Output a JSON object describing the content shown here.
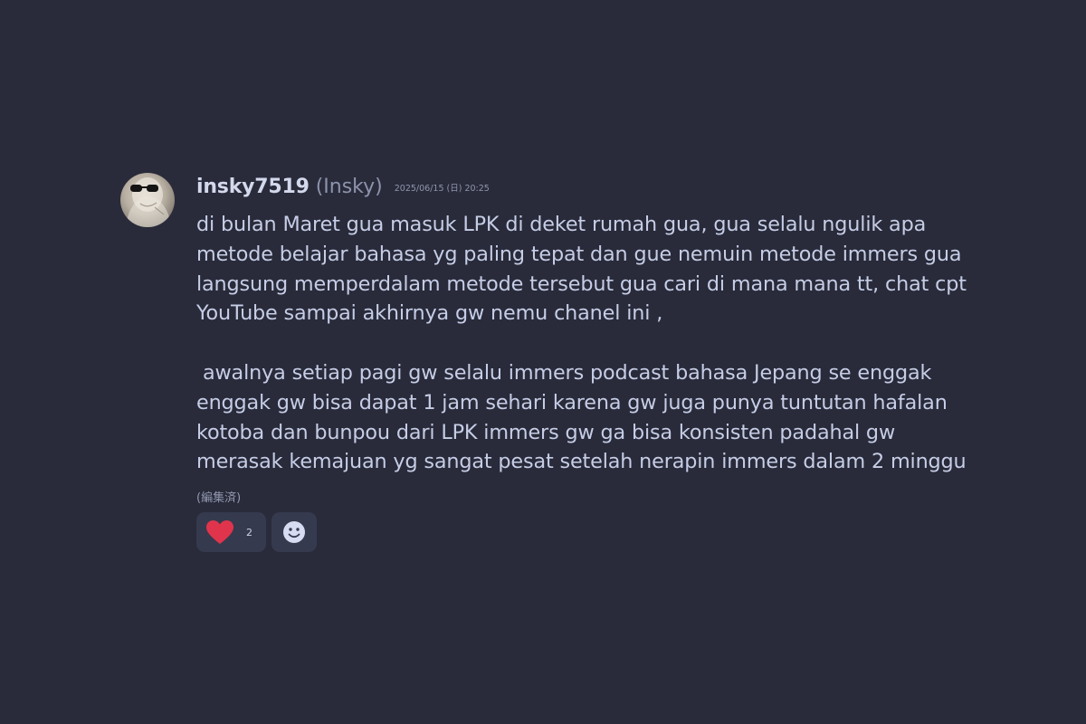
{
  "message": {
    "username": "insky7519",
    "display_name": "(Insky)",
    "timestamp": "2025/06/15 (日) 20:25",
    "body": "di bulan Maret gua masuk LPK di deket rumah gua, gua selalu ngulik apa\nmetode belajar bahasa yg paling tepat dan gue nemuin metode immers gua\nlangsung memperdalam metode tersebut gua cari di mana mana tt, chat cpt\nYouTube sampai akhirnya gw nemu chanel ini ,\n\n awalnya setiap pagi gw selalu immers podcast bahasa Jepang se enggak\nenggak gw bisa dapat 1 jam sehari karena gw juga punya tuntutan hafalan\nkotoba dan bunpou dari LPK immers gw ga bisa konsisten padahal gw\nmerasak kemajuan yg sangat pesat setelah nerapin immers dalam 2 minggu",
    "edited_label": "(編集済)",
    "avatar_icon": "sunglasses-avatar",
    "reactions": [
      {
        "icon": "heart-icon",
        "count": "2",
        "color": "#e0344c"
      },
      {
        "icon": "add-reaction-smiley-icon",
        "color": "#d6dcf2"
      }
    ]
  },
  "colors": {
    "background": "#292b3a",
    "reaction_bg": "#363a4f"
  }
}
